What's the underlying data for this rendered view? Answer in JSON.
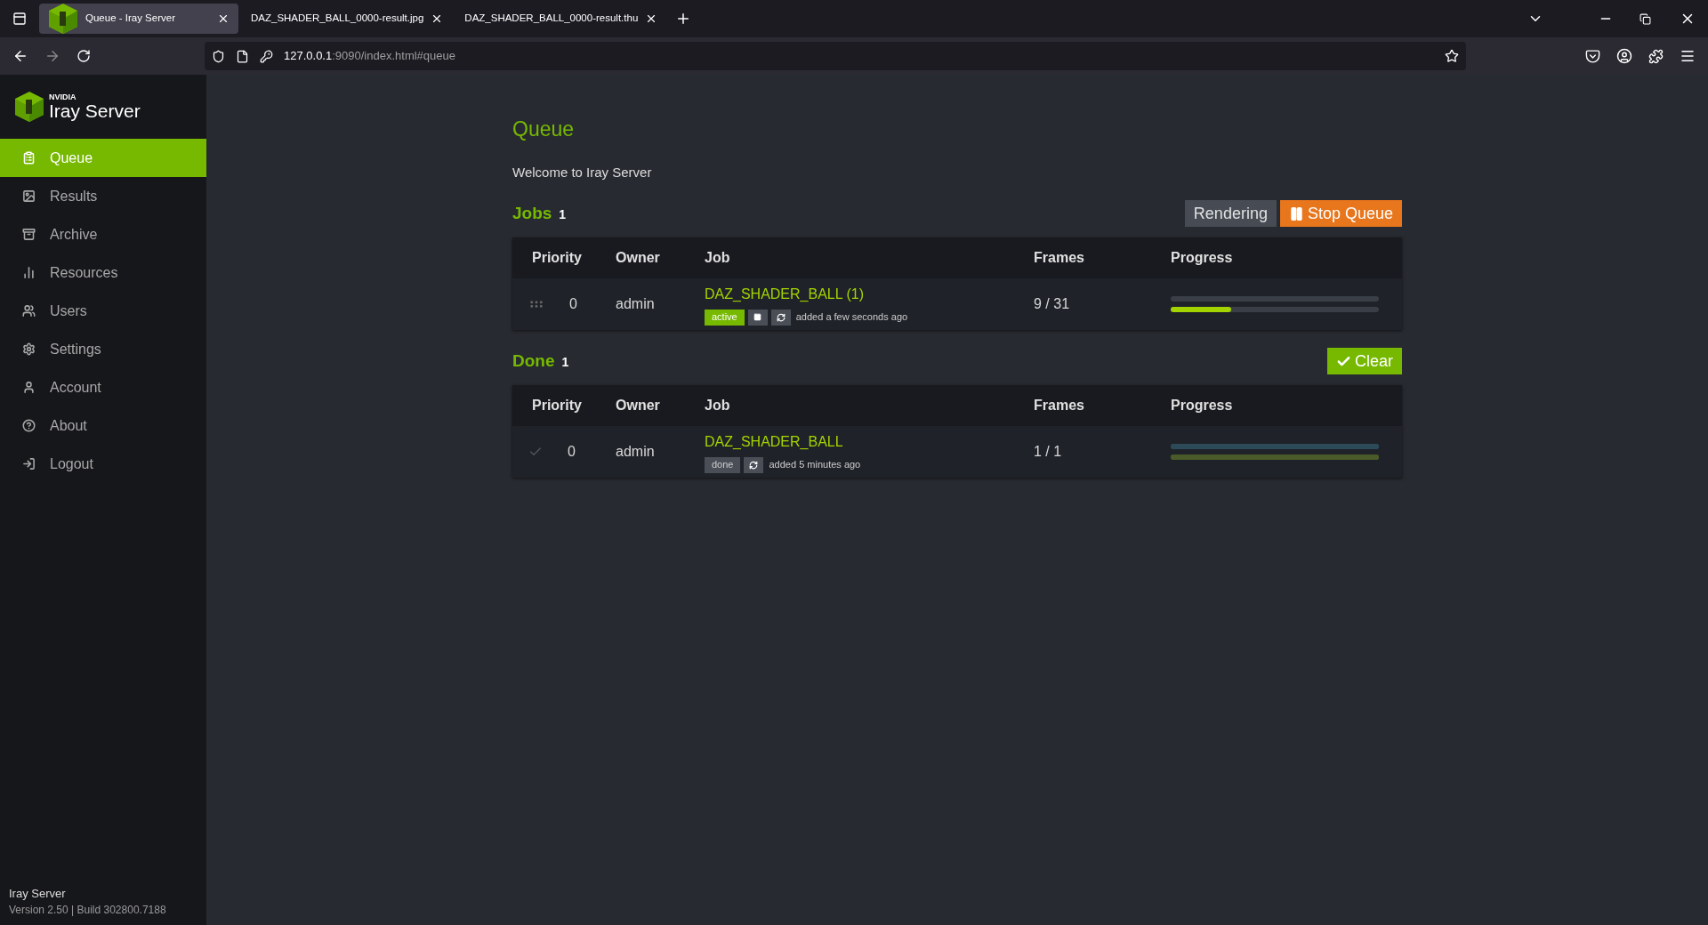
{
  "browser": {
    "tabs": [
      {
        "title": "Queue - Iray Server",
        "selected": true
      },
      {
        "title": "DAZ_SHADER_BALL_0000-result.jpg",
        "selected": false
      },
      {
        "title": "DAZ_SHADER_BALL_0000-result.thu",
        "selected": false
      }
    ],
    "url_host": "127.0.0.1",
    "url_rest": ":9090/index.html#queue"
  },
  "sidebar": {
    "logo_small": "NVIDIA",
    "logo_main": "Iray",
    "logo_suffix": "Server",
    "items": [
      {
        "label": "Queue",
        "selected": true
      },
      {
        "label": "Results",
        "selected": false
      },
      {
        "label": "Archive",
        "selected": false
      },
      {
        "label": "Resources",
        "selected": false
      },
      {
        "label": "Users",
        "selected": false
      },
      {
        "label": "Settings",
        "selected": false
      },
      {
        "label": "Account",
        "selected": false
      },
      {
        "label": "About",
        "selected": false
      },
      {
        "label": "Logout",
        "selected": false
      }
    ],
    "footer_title": "Iray Server",
    "footer_version": "Version 2.50 | Build 302800.7188"
  },
  "page": {
    "title": "Queue",
    "welcome": "Welcome to Iray Server"
  },
  "sections": [
    {
      "title": "Jobs",
      "count": "1",
      "buttons": [
        {
          "kind": "status",
          "label": "Rendering"
        },
        {
          "kind": "stop",
          "label": "Stop Queue"
        }
      ],
      "columns": [
        "Priority",
        "Owner",
        "Job",
        "Frames",
        "Progress"
      ],
      "rows": [
        {
          "finished": false,
          "priority": "0",
          "owner": "admin",
          "job": "DAZ_SHADER_BALL (1)",
          "badge": "active",
          "added": "added a few seconds ago",
          "frames": "9 / 31",
          "bars": [
            {
              "level": 0
            },
            {
              "level": 0.29
            }
          ]
        }
      ]
    },
    {
      "title": "Done",
      "count": "1",
      "buttons": [
        {
          "kind": "clear",
          "label": "Clear"
        }
      ],
      "columns": [
        "Priority",
        "Owner",
        "Job",
        "Frames",
        "Progress"
      ],
      "rows": [
        {
          "finished": true,
          "priority": "0",
          "owner": "admin",
          "job": "DAZ_SHADER_BALL",
          "badge": "done",
          "added": "added 5 minutes ago",
          "frames": "1 / 1",
          "bars": [
            {
              "level": 1
            },
            {
              "level": 1
            }
          ]
        }
      ]
    }
  ]
}
